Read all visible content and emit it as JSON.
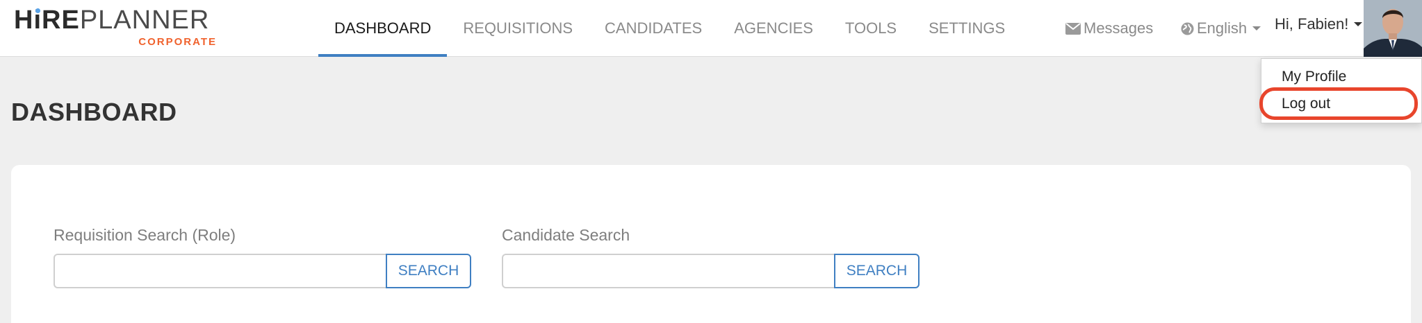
{
  "logo": {
    "letters_bold_start": "H",
    "letter_i": "i",
    "letters_bold_end": "RE",
    "letters_light": "PLANNER",
    "sub": "CORPORATE",
    "accent_color": "#f0622d",
    "dot_color": "#5aa3e8"
  },
  "nav": {
    "tabs": [
      {
        "label": "DASHBOARD",
        "active": true
      },
      {
        "label": "REQUISITIONS",
        "active": false
      },
      {
        "label": "CANDIDATES",
        "active": false
      },
      {
        "label": "AGENCIES",
        "active": false
      },
      {
        "label": "TOOLS",
        "active": false
      },
      {
        "label": "SETTINGS",
        "active": false
      }
    ],
    "active_color": "#3f7fc2",
    "messages_label": "Messages",
    "messages_icon": "envelope-icon",
    "language_label": "English",
    "language_icon": "globe-icon",
    "greeting": "Hi, Fabien!"
  },
  "user_menu": {
    "items": [
      {
        "label": "My Profile"
      },
      {
        "label": "Log out",
        "highlighted": true
      }
    ],
    "highlight_color": "#e8452c"
  },
  "page": {
    "title": "DASHBOARD"
  },
  "search": {
    "requisition": {
      "label": "Requisition Search (Role)",
      "value": "",
      "button": "SEARCH"
    },
    "candidate": {
      "label": "Candidate Search",
      "value": "",
      "button": "SEARCH"
    }
  }
}
